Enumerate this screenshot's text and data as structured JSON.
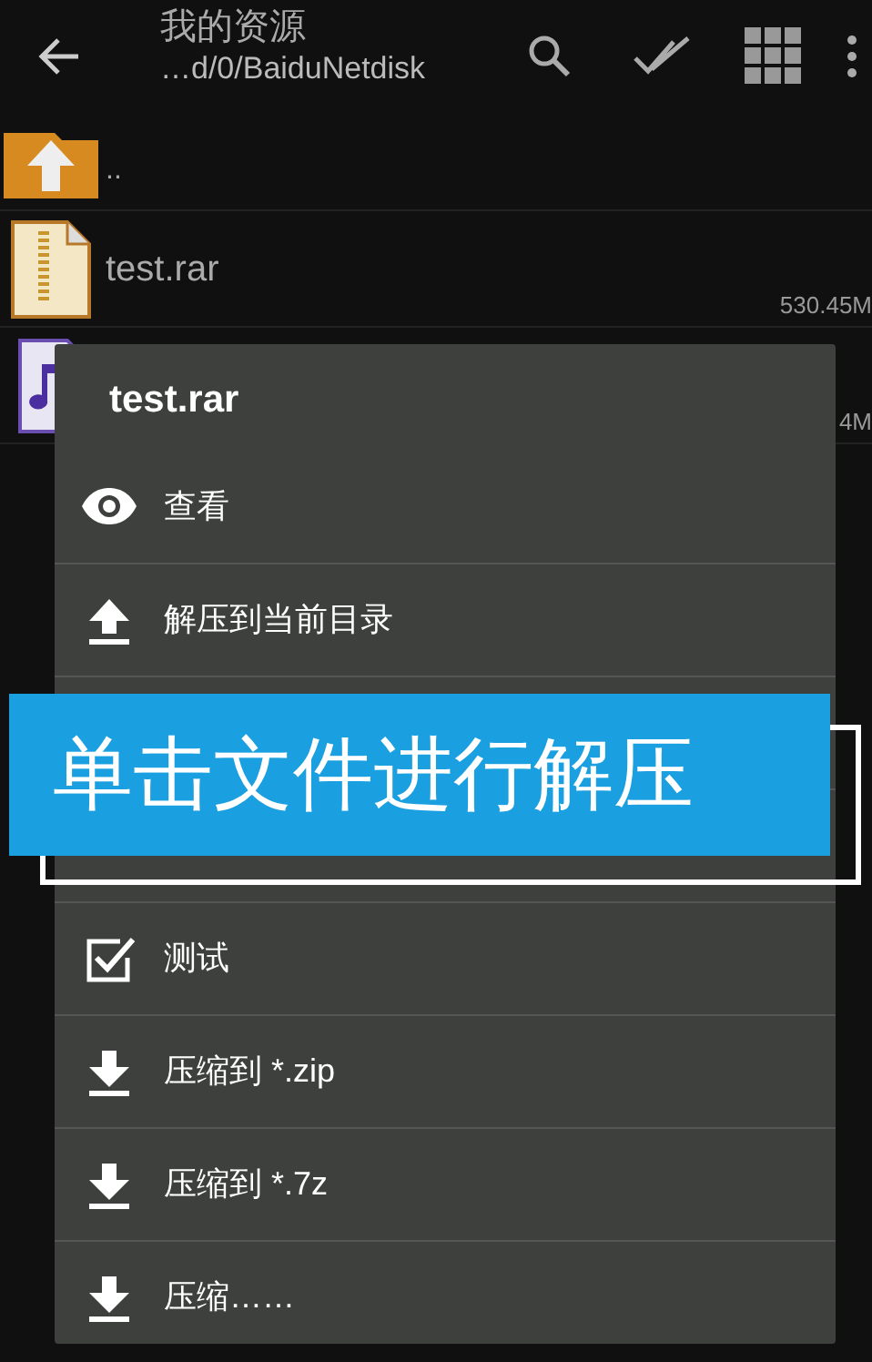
{
  "toolbar": {
    "title": "我的资源",
    "subtitle": "…d/0/BaiduNetdisk"
  },
  "files": [
    {
      "kind": "parent",
      "name": ".."
    },
    {
      "kind": "archive",
      "name": "test.rar",
      "size": "530.45M"
    },
    {
      "kind": "music",
      "size": "4M"
    }
  ],
  "dialog": {
    "title": "test.rar",
    "items": [
      {
        "kind": "view",
        "label": "查看"
      },
      {
        "kind": "upload",
        "label": "解压到当前目录"
      },
      {
        "kind": "hidden"
      },
      {
        "kind": "hidden"
      },
      {
        "kind": "check",
        "label": "测试"
      },
      {
        "kind": "download",
        "label": "压缩到 *.zip"
      },
      {
        "kind": "download",
        "label": "压缩到 *.7z"
      },
      {
        "kind": "download",
        "label": "压缩……"
      }
    ]
  },
  "banner": {
    "text": "单击文件进行解压"
  }
}
